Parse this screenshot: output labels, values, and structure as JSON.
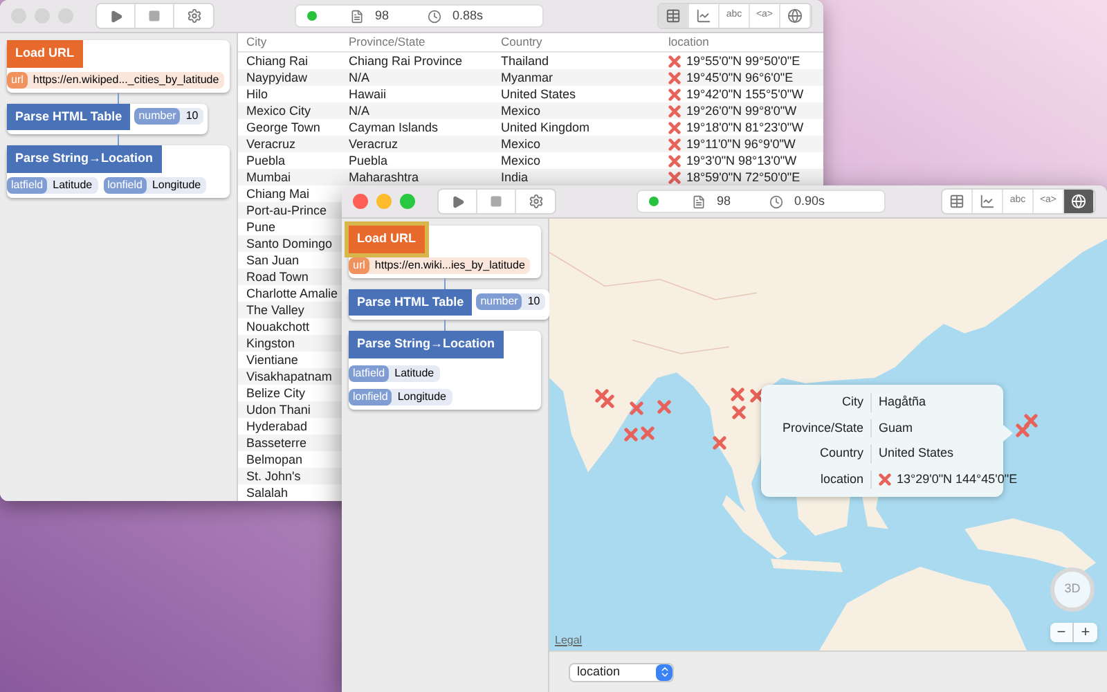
{
  "table_window": {
    "focused": false,
    "status": {
      "records": "98",
      "duration": "0.88s"
    },
    "views": [
      {
        "kind": "table",
        "selected": true
      },
      {
        "kind": "chart",
        "selected": false
      },
      {
        "kind": "text",
        "label": "abc",
        "selected": false
      },
      {
        "kind": "html",
        "label": "<a>",
        "selected": false
      },
      {
        "kind": "map",
        "selected": false
      }
    ],
    "nodes": [
      {
        "title": "Load URL",
        "kind": "row",
        "color": "#e8692c",
        "selected": false,
        "params": [
          {
            "key": "url",
            "value": "https://en.wikiped..._cities_by_latitude"
          }
        ]
      },
      {
        "title": "Parse HTML Table",
        "kind": "inline",
        "color": "#4a72b8",
        "selected": false,
        "params": [
          {
            "key": "number",
            "value": "10"
          }
        ]
      },
      {
        "title": "Parse String→Location",
        "kind": "row",
        "color": "#4a72b8",
        "selected": false,
        "params": [
          {
            "key": "latfield",
            "value": "Latitude"
          },
          {
            "key": "lonfield",
            "value": "Longitude"
          }
        ]
      }
    ],
    "table": {
      "columns": [
        "City",
        "Province/State",
        "Country",
        "location"
      ],
      "rows": [
        {
          "city": "Chiang Rai",
          "province": "Chiang Rai Province",
          "country": "Thailand",
          "location": "19°55'0\"N 99°50'0\"E"
        },
        {
          "city": "Naypyidaw",
          "province": "N/A",
          "country": "Myanmar",
          "location": "19°45'0\"N 96°6'0\"E"
        },
        {
          "city": "Hilo",
          "province": "Hawaii",
          "country": "United States",
          "location": "19°42'0\"N 155°5'0\"W"
        },
        {
          "city": "Mexico City",
          "province": "N/A",
          "country": "Mexico",
          "location": "19°26'0\"N 99°8'0\"W"
        },
        {
          "city": "George Town",
          "province": "Cayman Islands",
          "country": "United Kingdom",
          "location": "19°18'0\"N 81°23'0\"W"
        },
        {
          "city": "Veracruz",
          "province": "Veracruz",
          "country": "Mexico",
          "location": "19°11'0\"N 96°9'0\"W"
        },
        {
          "city": "Puebla",
          "province": "Puebla",
          "country": "Mexico",
          "location": "19°3'0\"N 98°13'0\"W"
        },
        {
          "city": "Mumbai",
          "province": "Maharashtra",
          "country": "India",
          "location": "18°59'0\"N 72°50'0\"E"
        },
        {
          "city": "Chiang Mai"
        },
        {
          "city": "Port-au-Prince"
        },
        {
          "city": "Pune"
        },
        {
          "city": "Santo Domingo"
        },
        {
          "city": "San Juan"
        },
        {
          "city": "Road Town"
        },
        {
          "city": "Charlotte Amalie"
        },
        {
          "city": "The Valley"
        },
        {
          "city": "Nouakchott"
        },
        {
          "city": "Kingston"
        },
        {
          "city": "Vientiane"
        },
        {
          "city": "Visakhapatnam"
        },
        {
          "city": "Belize City"
        },
        {
          "city": "Udon Thani"
        },
        {
          "city": "Hyderabad"
        },
        {
          "city": "Basseterre"
        },
        {
          "city": "Belmopan"
        },
        {
          "city": "St. John's"
        },
        {
          "city": "Salalah"
        }
      ]
    }
  },
  "map_window": {
    "focused": true,
    "status": {
      "records": "98",
      "duration": "0.90s"
    },
    "views": [
      {
        "kind": "table",
        "selected": false
      },
      {
        "kind": "chart",
        "selected": false
      },
      {
        "kind": "text",
        "label": "abc",
        "selected": false
      },
      {
        "kind": "html",
        "label": "<a>",
        "selected": false
      },
      {
        "kind": "map",
        "selected": true
      }
    ],
    "nodes": [
      {
        "title": "Load URL",
        "kind": "row",
        "color": "#e8692c",
        "selected": true,
        "params": [
          {
            "key": "url",
            "value": "https://en.wiki...ies_by_latitude"
          }
        ]
      },
      {
        "title": "Parse HTML Table",
        "kind": "inline",
        "color": "#4a72b8",
        "selected": false,
        "params": [
          {
            "key": "number",
            "value": "10"
          }
        ]
      },
      {
        "title": "Parse String→Location",
        "kind": "stacked",
        "color": "#4a72b8",
        "selected": false,
        "params": [
          {
            "key": "latfield",
            "value": "Latitude"
          },
          {
            "key": "lonfield",
            "value": "Longitude"
          }
        ]
      }
    ],
    "map": {
      "tooltip": [
        {
          "label": "City",
          "value": "Hagåtña",
          "kind": "text"
        },
        {
          "label": "Province/State",
          "value": "Guam",
          "kind": "text"
        },
        {
          "label": "Country",
          "value": "United States",
          "kind": "text"
        },
        {
          "label": "location",
          "value": "13°29'0\"N 144°45'0\"E",
          "kind": "location"
        }
      ],
      "compass_label": "3D",
      "zoom_out": "−",
      "zoom_in": "+",
      "legal_link": "Legal"
    },
    "field_select": {
      "value": "location"
    }
  }
}
